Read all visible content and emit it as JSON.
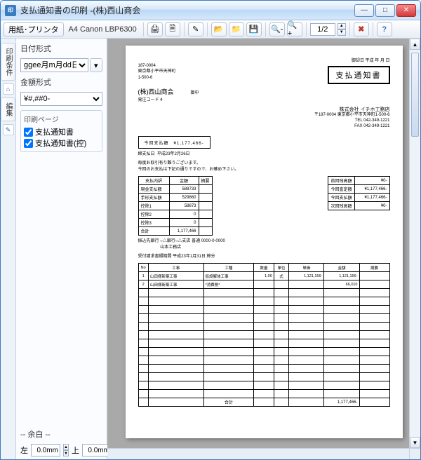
{
  "window": {
    "title": "支払通知書の印刷  -(株)西山商会"
  },
  "toolbar": {
    "btn_paper": "用紙･プリンタ",
    "paper_info": "A4   Canon LBP6300",
    "page_field": "1/2"
  },
  "tabs": {
    "t1": "印刷条件",
    "t2": "編集"
  },
  "sidebar": {
    "date_label": "日付形式",
    "date_value": "ggee月m月dd日",
    "money_label": "金額形式",
    "money_value": "¥#,##0-",
    "pages_label": "印刷ページ",
    "chk1": "支払通知書",
    "chk2": "支払通知書(控)",
    "margin_label": "-- 余白 --",
    "left_lbl": "左",
    "left_val": "0.0mm",
    "top_lbl": "上",
    "top_val": "0.0mm"
  },
  "doc": {
    "date_top": "御却日 平成  年  月  日",
    "zip": "187-0004",
    "addr": "東京都小平市天神町",
    "code": "1-500-6",
    "recipient": "(株)西山商会",
    "honorific": "御中",
    "buyer_code": "発注コード 4",
    "title": "支払通知書",
    "sender_corp": "株式会社 イチホ工務店",
    "sender_addr": "〒187-0004 東京都小平市天神町1-500-6",
    "sender_tel": "TEL 042-349-1221",
    "sender_fax": "FAX 042-349-1221",
    "amount_label": "今回支払額",
    "amount": "¥1,177,466-",
    "settle_date_lbl": "締支払日",
    "settle_date": "平成23年2月26日",
    "greeting1": "毎度お取引有り難うございます。",
    "greeting2": "今回のお支払は下記の通りですので、お確め下さい。",
    "breakdown_headers": [
      "支払内訳",
      "金額",
      "摘要"
    ],
    "breakdown_rows": [
      [
        "現金支払額",
        "588733",
        ""
      ],
      [
        "手形支払額",
        "529860",
        ""
      ],
      [
        "控除1",
        "58873",
        ""
      ],
      [
        "控除2",
        "0",
        ""
      ],
      [
        "控除3",
        "0",
        ""
      ]
    ],
    "breakdown_total_lbl": "合計",
    "breakdown_total_val": "1,177,466",
    "summary_rows": [
      [
        "前回残高額",
        "¥0-"
      ],
      [
        "今回査定額",
        "¥1,177,466-"
      ],
      [
        "今回支払額",
        "¥1,177,466-"
      ],
      [
        "次回残高額",
        "¥0-"
      ]
    ],
    "bank1": "振込先銀行 ○△銀行○△支店 普通 0000-0-0000",
    "bank2": "　　　　　 山本工務店",
    "period": "受付請求書綴期間 平成23年1月31日 締分",
    "detail_headers": [
      "No",
      "工事",
      "工種",
      "数量",
      "単位",
      "単価",
      "金額",
      "摘要"
    ],
    "detail_rows": [
      {
        "no": "1",
        "name": "山田様新築工事",
        "kind": "仮設解体工事",
        "qty": "1.00",
        "unit": "式",
        "price": "1,121,156-",
        "amt": "1,121,156-",
        "note": ""
      },
      {
        "no": "2",
        "name": "山田様新築工事",
        "kind": "*消費税*",
        "qty": "",
        "unit": "",
        "price": "",
        "amt": "66,010",
        "note": ""
      }
    ],
    "detail_total_lbl": "合計",
    "detail_total_amt": "1,177,466-"
  }
}
